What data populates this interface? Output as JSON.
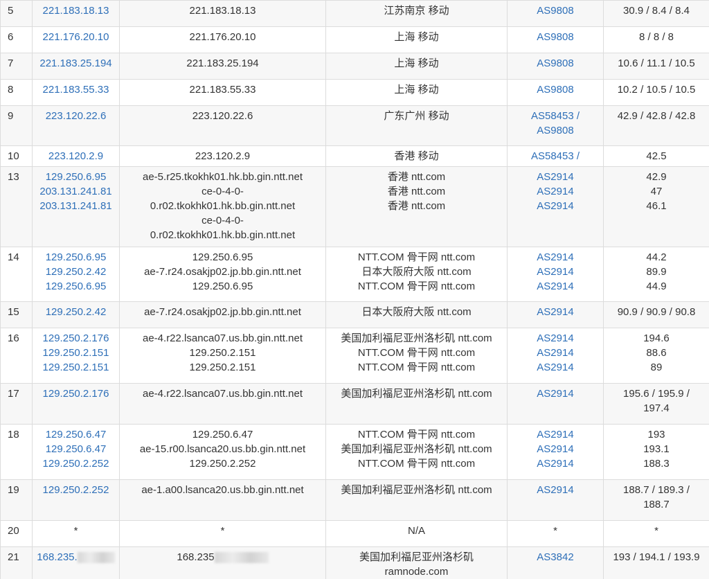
{
  "rows": [
    {
      "hop": "5",
      "ip": [
        "221.183.18.13"
      ],
      "host": [
        "221.183.18.13"
      ],
      "loc": [
        "江苏南京 移动"
      ],
      "as": [
        "AS9808"
      ],
      "time": [
        "30.9 / 8.4 / 8.4"
      ],
      "h": 38,
      "alt": true
    },
    {
      "hop": "6",
      "ip": [
        "221.176.20.10"
      ],
      "host": [
        "221.176.20.10"
      ],
      "loc": [
        "上海 移动"
      ],
      "as": [
        "AS9808"
      ],
      "time": [
        "8 / 8 / 8"
      ],
      "h": 38,
      "alt": false
    },
    {
      "hop": "7",
      "ip": [
        "221.183.25.194"
      ],
      "host": [
        "221.183.25.194"
      ],
      "loc": [
        "上海 移动"
      ],
      "as": [
        "AS9808"
      ],
      "time": [
        "10.6 / 11.1 / 10.5"
      ],
      "h": 38,
      "alt": true
    },
    {
      "hop": "8",
      "ip": [
        "221.183.55.33"
      ],
      "host": [
        "221.183.55.33"
      ],
      "loc": [
        "上海 移动"
      ],
      "as": [
        "AS9808"
      ],
      "time": [
        "10.2 / 10.5 / 10.5"
      ],
      "h": 38,
      "alt": false
    },
    {
      "hop": "9",
      "ip": [
        "223.120.22.6"
      ],
      "host": [
        "223.120.22.6"
      ],
      "loc": [
        "广东广州 移动"
      ],
      "as": [
        "AS58453 /",
        "AS9808"
      ],
      "time": [
        "42.9 / 42.8 / 42.8"
      ],
      "h": 58,
      "alt": true
    },
    {
      "hop": "10",
      "ip": [
        "223.120.2.9"
      ],
      "host": [
        "223.120.2.9"
      ],
      "loc": [
        "香港 移动"
      ],
      "as": [
        "AS58453 /"
      ],
      "time": [
        "42.5"
      ],
      "h": 30,
      "alt": false
    },
    {
      "hop": "13",
      "ip": [
        "129.250.6.95",
        "203.131.241.81",
        "203.131.241.81"
      ],
      "host": [
        "ae-5.r25.tkokhk01.hk.bb.gin.ntt.net",
        "ce-0-4-0-",
        "0.r02.tkokhk01.hk.bb.gin.ntt.net",
        "ce-0-4-0-",
        "0.r02.tkokhk01.hk.bb.gin.ntt.net"
      ],
      "loc": [
        "香港 ntt.com",
        "香港 ntt.com",
        "香港 ntt.com"
      ],
      "as": [
        "AS2914",
        "AS2914",
        "AS2914"
      ],
      "time": [
        "42.9",
        "47",
        "46.1"
      ],
      "h": 116,
      "alt": true
    },
    {
      "hop": "14",
      "ip": [
        "129.250.6.95",
        "129.250.2.42",
        "129.250.6.95"
      ],
      "host": [
        "129.250.6.95",
        "ae-7.r24.osakjp02.jp.bb.gin.ntt.net",
        "129.250.6.95"
      ],
      "loc": [
        "NTT.COM 骨干网 ntt.com",
        "日本大阪府大阪 ntt.com",
        "NTT.COM 骨干网 ntt.com"
      ],
      "as": [
        "AS2914",
        "AS2914",
        "AS2914"
      ],
      "time": [
        "44.2",
        "89.9",
        "44.9"
      ],
      "h": 79,
      "alt": false
    },
    {
      "hop": "15",
      "ip": [
        "129.250.2.42"
      ],
      "host": [
        "ae-7.r24.osakjp02.jp.bb.gin.ntt.net"
      ],
      "loc": [
        "日本大阪府大阪 ntt.com"
      ],
      "as": [
        "AS2914"
      ],
      "time": [
        "90.9 / 90.9 / 90.8"
      ],
      "h": 38,
      "alt": true
    },
    {
      "hop": "16",
      "ip": [
        "129.250.2.176",
        "129.250.2.151",
        "129.250.2.151"
      ],
      "host": [
        "ae-4.r22.lsanca07.us.bb.gin.ntt.net",
        "129.250.2.151",
        "129.250.2.151"
      ],
      "loc": [
        "美国加利福尼亚州洛杉矶 ntt.com",
        "NTT.COM 骨干网 ntt.com",
        "NTT.COM 骨干网 ntt.com"
      ],
      "as": [
        "AS2914",
        "AS2914",
        "AS2914"
      ],
      "time": [
        "194.6",
        "88.6",
        "89"
      ],
      "h": 80,
      "alt": false
    },
    {
      "hop": "17",
      "ip": [
        "129.250.2.176"
      ],
      "host": [
        "ae-4.r22.lsanca07.us.bb.gin.ntt.net"
      ],
      "loc": [
        "美国加利福尼亚州洛杉矶 ntt.com"
      ],
      "as": [
        "AS2914"
      ],
      "time": [
        "195.6 / 195.9 /",
        "197.4"
      ],
      "h": 59,
      "alt": true
    },
    {
      "hop": "18",
      "ip": [
        "129.250.6.47",
        "129.250.6.47",
        "129.250.2.252"
      ],
      "host": [
        "129.250.6.47",
        "ae-15.r00.lsanca20.us.bb.gin.ntt.net",
        "129.250.2.252"
      ],
      "loc": [
        "NTT.COM 骨干网 ntt.com",
        "美国加利福尼亚州洛杉矶 ntt.com",
        "NTT.COM 骨干网 ntt.com"
      ],
      "as": [
        "AS2914",
        "AS2914",
        "AS2914"
      ],
      "time": [
        "193",
        "193.1",
        "188.3"
      ],
      "h": 80,
      "alt": false
    },
    {
      "hop": "19",
      "ip": [
        "129.250.2.252"
      ],
      "host": [
        "ae-1.a00.lsanca20.us.bb.gin.ntt.net"
      ],
      "loc": [
        "美国加利福尼亚州洛杉矶 ntt.com"
      ],
      "as": [
        "AS2914"
      ],
      "time": [
        "188.7 / 189.3 /",
        "188.7"
      ],
      "h": 59,
      "alt": true
    },
    {
      "hop": "20",
      "ip": [
        "*"
      ],
      "host": [
        "*"
      ],
      "loc": [
        "N/A"
      ],
      "as": [
        "*"
      ],
      "time": [
        "*"
      ],
      "h": 38,
      "alt": false
    },
    {
      "hop": "21",
      "ip": [
        "168.235."
      ],
      "host": [
        "168.235"
      ],
      "loc": [
        "美国加利福尼亚州洛杉矶",
        "ramnode.com"
      ],
      "as": [
        "AS3842"
      ],
      "time": [
        "193 / 194.1 / 193.9"
      ],
      "h": 50,
      "alt": true,
      "masked": true
    }
  ]
}
